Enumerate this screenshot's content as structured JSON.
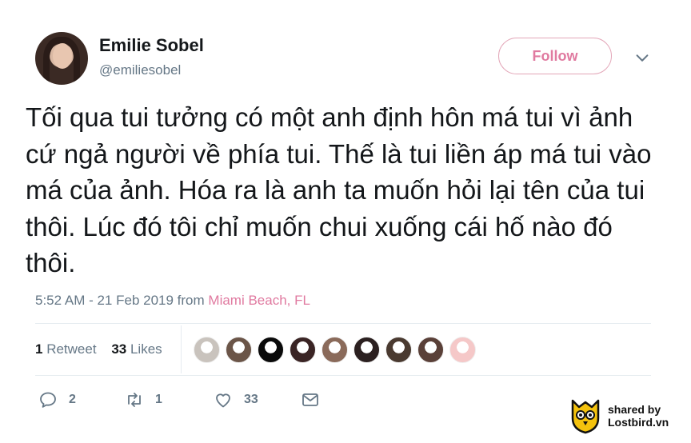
{
  "user": {
    "name": "Emilie Sobel",
    "handle": "@emiliesobel"
  },
  "follow_label": "Follow",
  "tweet": {
    "text": "Tối qua tui tưởng có một anh định hôn má tui vì ảnh cứ ngả người về phía tui. Thế là tui liền áp má tui vào má của ảnh. Hóa ra là anh ta muốn hỏi lại tên của tui thôi. Lúc đó tôi chỉ muốn chui xuống cái hố nào đó thôi.",
    "timestamp": "5:52 AM - 21 Feb 2019 from ",
    "location": "Miami Beach, FL"
  },
  "stats": {
    "retweets_count": "1",
    "retweets_label": "Retweet",
    "likes_count": "33",
    "likes_label": "Likes"
  },
  "likers": [
    {
      "name": "liker-1",
      "color": "#c9c3bd"
    },
    {
      "name": "liker-2",
      "color": "#6b5548"
    },
    {
      "name": "liker-3",
      "color": "#0a0a0a"
    },
    {
      "name": "liker-4",
      "color": "#3a2424"
    },
    {
      "name": "liker-5",
      "color": "#8a6a5a"
    },
    {
      "name": "liker-6",
      "color": "#2b2020"
    },
    {
      "name": "liker-7",
      "color": "#4a3a30"
    },
    {
      "name": "liker-8",
      "color": "#5a4038"
    },
    {
      "name": "liker-9",
      "color": "#f5c8c8"
    }
  ],
  "actions": {
    "reply_count": "2",
    "retweet_count": "1",
    "like_count": "33"
  },
  "watermark": {
    "line1": "shared by",
    "line2": "Lostbird.vn"
  },
  "colors": {
    "accent": "#e07aa0",
    "muted": "#657786",
    "text": "#14171a"
  }
}
